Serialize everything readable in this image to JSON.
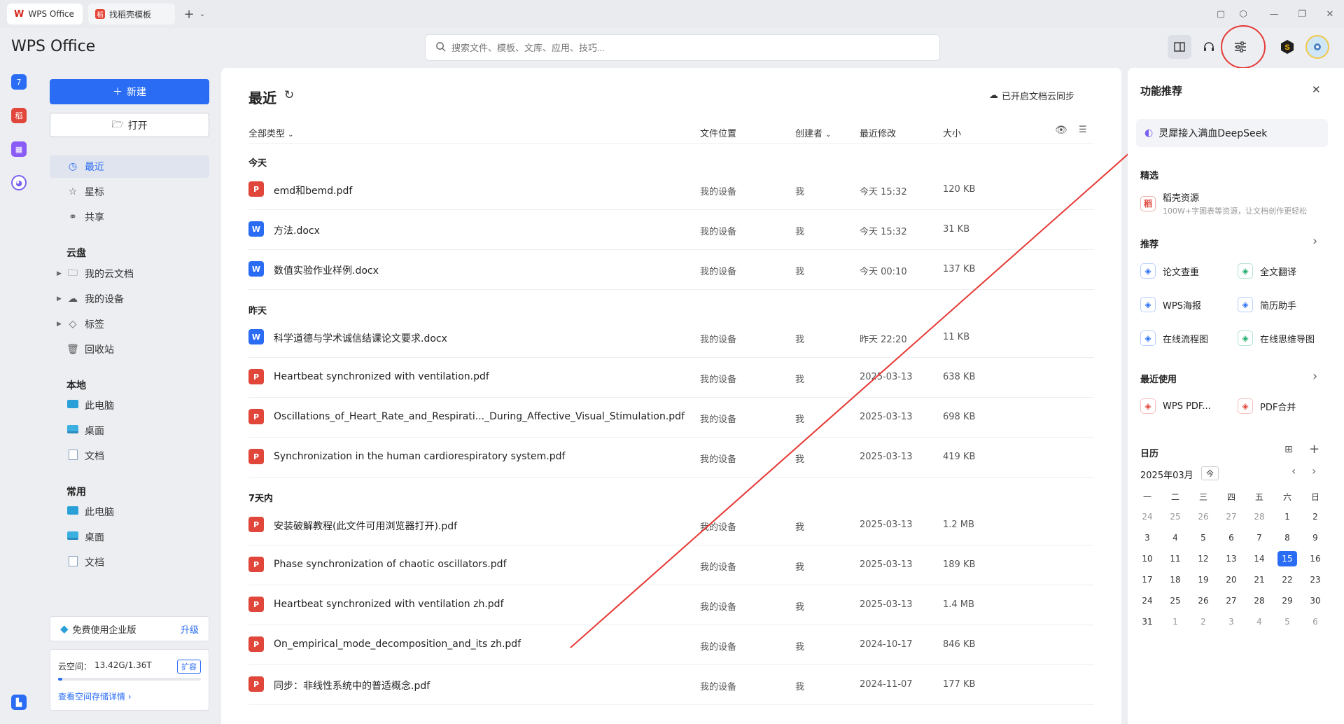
{
  "tabs": [
    {
      "label": "WPS Office",
      "active": true
    },
    {
      "label": "找稻壳模板",
      "active": false
    }
  ],
  "app_title": "WPS Office",
  "search": {
    "placeholder": "搜索文件、模板、文库、应用、技巧..."
  },
  "sidebar": {
    "new_label": "新建",
    "open_label": "打开",
    "nav_top": [
      {
        "label": "最近",
        "icon": "clock-icon",
        "selected": true
      },
      {
        "label": "星标",
        "icon": "star-icon",
        "selected": false
      },
      {
        "label": "共享",
        "icon": "share-icon",
        "selected": false
      }
    ],
    "cloud_head": "云盘",
    "cloud_items": [
      {
        "label": "我的云文档",
        "icon": "folder-icon"
      },
      {
        "label": "我的设备",
        "icon": "cloud-device-icon"
      },
      {
        "label": "标签",
        "icon": "tag-icon"
      },
      {
        "label": "回收站",
        "icon": "trash-icon"
      }
    ],
    "local_head": "本地",
    "local_items": [
      {
        "label": "此电脑",
        "icon": "pc-icon"
      },
      {
        "label": "桌面",
        "icon": "desktop-icon"
      },
      {
        "label": "文档",
        "icon": "document-icon"
      }
    ],
    "common_head": "常用",
    "common_items": [
      {
        "label": "此电脑",
        "icon": "pc-icon"
      },
      {
        "label": "桌面",
        "icon": "desktop-icon"
      },
      {
        "label": "文档",
        "icon": "document-icon"
      }
    ],
    "promo_text": "免费使用企业版",
    "promo_link": "升级",
    "storage_label": "云空间：",
    "storage_value": "13.42G/1.36T",
    "storage_used_fraction": 0.01,
    "expand_label": "扩容",
    "storage_detail": "查看空间存储详情 ›"
  },
  "main": {
    "title": "最近",
    "sync_status": "已开启文档云同步",
    "columns": {
      "type": "全部类型",
      "location": "文件位置",
      "creator": "创建者",
      "modified": "最近修改",
      "size": "大小"
    },
    "groups": [
      {
        "label": "今天",
        "files": [
          {
            "name": "emd和bemd.pdf",
            "type": "pdf",
            "location": "我的设备",
            "creator": "我",
            "modified": "今天 15:32",
            "size": "120 KB"
          },
          {
            "name": "方法.docx",
            "type": "doc",
            "location": "我的设备",
            "creator": "我",
            "modified": "今天 15:32",
            "size": "31 KB"
          },
          {
            "name": "数值实验作业样例.docx",
            "type": "doc",
            "location": "我的设备",
            "creator": "我",
            "modified": "今天 00:10",
            "size": "137 KB"
          }
        ]
      },
      {
        "label": "昨天",
        "files": [
          {
            "name": "科学道德与学术诚信结课论文要求.docx",
            "type": "doc",
            "location": "我的设备",
            "creator": "我",
            "modified": "昨天 22:20",
            "size": "11 KB"
          },
          {
            "name": "Heartbeat synchronized with ventilation.pdf",
            "type": "pdf",
            "location": "我的设备",
            "creator": "我",
            "modified": "2025-03-13",
            "size": "638 KB"
          },
          {
            "name": "Oscillations_of_Heart_Rate_and_Respirati..._During_Affective_Visual_Stimulation.pdf",
            "type": "pdf",
            "location": "我的设备",
            "creator": "我",
            "modified": "2025-03-13",
            "size": "698 KB"
          },
          {
            "name": "Synchronization in the human cardiorespiratory system.pdf",
            "type": "pdf",
            "location": "我的设备",
            "creator": "我",
            "modified": "2025-03-13",
            "size": "419 KB"
          }
        ]
      },
      {
        "label": "7天内",
        "files": [
          {
            "name": "安装破解教程(此文件可用浏览器打开).pdf",
            "type": "pdf",
            "location": "我的设备",
            "creator": "我",
            "modified": "2025-03-13",
            "size": "1.2 MB"
          },
          {
            "name": "Phase synchronization of chaotic oscillators.pdf",
            "type": "pdf",
            "location": "我的设备",
            "creator": "我",
            "modified": "2025-03-13",
            "size": "189 KB"
          },
          {
            "name": "Heartbeat synchronized with ventilation zh.pdf",
            "type": "pdf",
            "location": "我的设备",
            "creator": "我",
            "modified": "2025-03-13",
            "size": "1.4 MB"
          },
          {
            "name": "On_empirical_mode_decomposition_and_its zh.pdf",
            "type": "pdf",
            "location": "我的设备",
            "creator": "我",
            "modified": "2024-10-17",
            "size": "846 KB"
          },
          {
            "name": "同步：非线性系统中的普适概念.pdf",
            "type": "pdf",
            "location": "我的设备",
            "creator": "我",
            "modified": "2024-11-07",
            "size": "177 KB"
          }
        ]
      }
    ]
  },
  "right": {
    "title": "功能推荐",
    "deepseek": "灵犀接入满血DeepSeek",
    "featured_head": "精选",
    "featured_title": "稻壳资源",
    "featured_desc": "100W+字图表等资源，让文档创作更轻松",
    "rec_head": "推荐",
    "rec_items": [
      {
        "label": "论文查重",
        "icon": "plagiarism-check-icon",
        "color": "#2a6df4"
      },
      {
        "label": "全文翻译",
        "icon": "translate-icon",
        "color": "#1aab6a"
      },
      {
        "label": "WPS海报",
        "icon": "poster-icon",
        "color": "#2a6df4"
      },
      {
        "label": "简历助手",
        "icon": "resume-icon",
        "color": "#2a6df4"
      },
      {
        "label": "在线流程图",
        "icon": "flowchart-icon",
        "color": "#2a6df4"
      },
      {
        "label": "在线思维导图",
        "icon": "mindmap-icon",
        "color": "#1aab6a"
      }
    ],
    "recent_head": "最近使用",
    "recent_items": [
      {
        "label": "WPS PDF...",
        "icon": "pdf-icon",
        "color": "#e0463a"
      },
      {
        "label": "PDF合并",
        "icon": "pdf-merge-icon",
        "color": "#e0463a"
      }
    ],
    "calendar_head": "日历",
    "calendar_month": "2025年03月",
    "calendar_today_btn": "今",
    "weekdays": [
      "一",
      "二",
      "三",
      "四",
      "五",
      "六",
      "日"
    ],
    "weeks": [
      [
        "24",
        "25",
        "26",
        "27",
        "28",
        "1",
        "2"
      ],
      [
        "3",
        "4",
        "5",
        "6",
        "7",
        "8",
        "9"
      ],
      [
        "10",
        "11",
        "12",
        "13",
        "14",
        "15",
        "16"
      ],
      [
        "17",
        "18",
        "19",
        "20",
        "21",
        "22",
        "23"
      ],
      [
        "24",
        "25",
        "26",
        "27",
        "28",
        "29",
        "30"
      ],
      [
        "31",
        "1",
        "2",
        "3",
        "4",
        "5",
        "6"
      ]
    ],
    "today": "15"
  },
  "colors": {
    "accent": "#2a6df4",
    "pdf": "#e0463a",
    "annotation": "#e53935"
  }
}
